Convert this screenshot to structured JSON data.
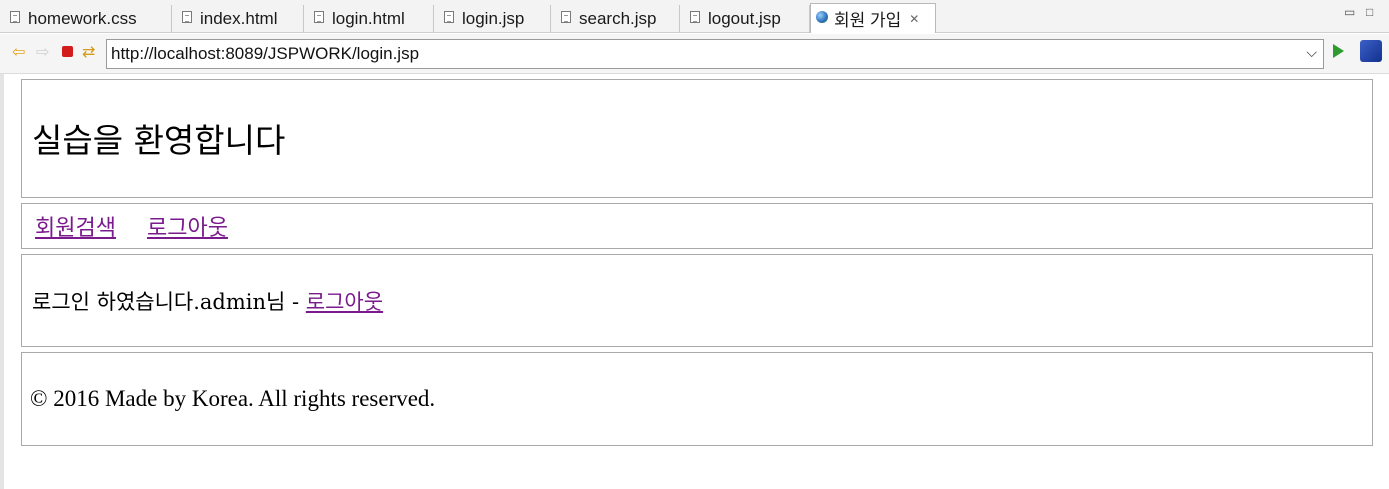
{
  "tabs": [
    {
      "label": "homework.css",
      "icon": "document-icon",
      "active": false
    },
    {
      "label": "index.html",
      "icon": "document-icon",
      "active": false
    },
    {
      "label": "login.html",
      "icon": "document-icon",
      "active": false
    },
    {
      "label": "login.jsp",
      "icon": "document-icon",
      "active": false
    },
    {
      "label": "search.jsp",
      "icon": "document-icon",
      "active": false
    },
    {
      "label": "logout.jsp",
      "icon": "document-icon",
      "active": false
    },
    {
      "label": "회원 가입",
      "icon": "globe-icon",
      "active": true
    }
  ],
  "tab_close_glyph": "✕",
  "window_controls": {
    "minimize": "▭",
    "maximize": "□"
  },
  "toolbar": {
    "back_glyph": "⇦",
    "forward_glyph": "⇨",
    "refresh_glyph": "⇄",
    "url": "http://localhost:8089/JSPWORK/login.jsp",
    "dropdown_glyph": "⌵"
  },
  "page": {
    "title": "실습을 환영합니다",
    "menu": [
      {
        "label": "회원검색"
      },
      {
        "label": "로그아웃"
      }
    ],
    "login_message": "로그인 하였습니다.admin님 - ",
    "login_logout_link": "로그아웃",
    "footer": "© 2016 Made by Korea. All rights reserved."
  },
  "colors": {
    "visited_link": "#7a1a8c",
    "border": "#a9a9a9"
  }
}
